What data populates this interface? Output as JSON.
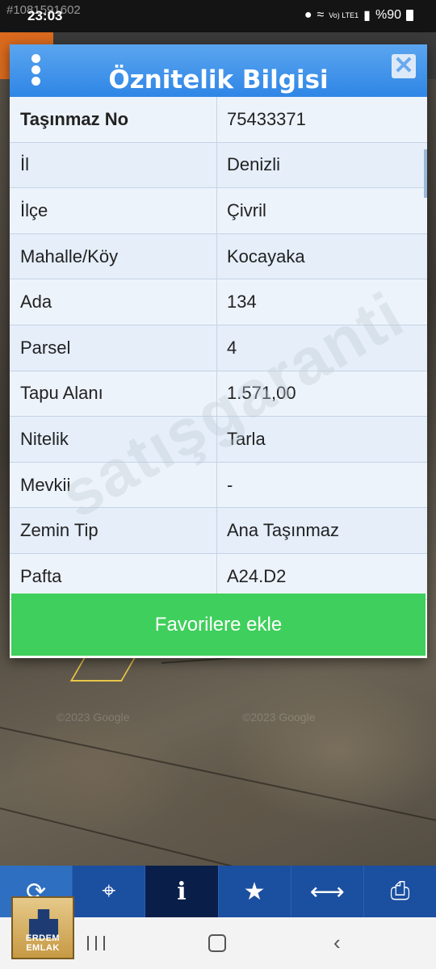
{
  "status_bar": {
    "time": "23:03",
    "overlay_id": "#1081591602",
    "battery": "%90",
    "network": "Vo) LTE1"
  },
  "dialog": {
    "title": "Öznitelik Bilgisi",
    "close_glyph": "✕",
    "rows": [
      {
        "key": "Taşınmaz No",
        "value": "75433371"
      },
      {
        "key": "İl",
        "value": "Denizli"
      },
      {
        "key": "İlçe",
        "value": "Çivril"
      },
      {
        "key": "Mahalle/Köy",
        "value": "Kocayaka"
      },
      {
        "key": "Ada",
        "value": "134"
      },
      {
        "key": "Parsel",
        "value": "4"
      },
      {
        "key": "Tapu Alanı",
        "value": "1.571,00"
      },
      {
        "key": "Nitelik",
        "value": "Tarla"
      },
      {
        "key": "Mevkii",
        "value": "-"
      },
      {
        "key": "Zemin Tip",
        "value": "Ana Taşınmaz"
      },
      {
        "key": "Pafta",
        "value": "A24.D2"
      }
    ],
    "favorite_button": "Favorilere ekle"
  },
  "watermark": "satışgaranti",
  "map_watermarks": [
    "©2023 Google",
    "©2023 Google"
  ],
  "toolbar": {
    "items": [
      {
        "name": "refresh-icon",
        "glyph": "⟳"
      },
      {
        "name": "locate-icon",
        "glyph": "⌖"
      },
      {
        "name": "info-icon",
        "glyph": "i"
      },
      {
        "name": "star-icon",
        "glyph": "★"
      },
      {
        "name": "measure-icon",
        "glyph": "⟷"
      },
      {
        "name": "print-icon",
        "glyph": "⎙"
      }
    ]
  },
  "logo": {
    "text": "ERDEM EMLAK"
  },
  "nav": {
    "back_glyph": "‹"
  },
  "colors": {
    "header_blue": "#2f86e6",
    "button_green": "#3fcf5c",
    "toolbar_blue": "#1b4fa0"
  }
}
